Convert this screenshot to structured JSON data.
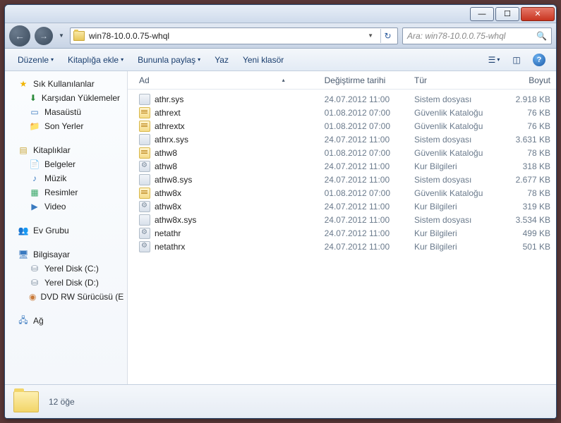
{
  "title_controls": {
    "min": "—",
    "max": "☐",
    "close": "✕"
  },
  "nav": {
    "back": "←",
    "fwd": "→",
    "drop": "▼"
  },
  "address": {
    "path": "win78-10.0.0.75-whql",
    "drop": "▼",
    "refresh": "↻"
  },
  "search": {
    "placeholder": "Ara: win78-10.0.0.75-whql",
    "icon": "🔍"
  },
  "toolbar": {
    "organize": "Düzenle",
    "library": "Kitaplığa ekle",
    "share": "Bununla paylaş",
    "burn": "Yaz",
    "newfolder": "Yeni klasör",
    "drop": "▾"
  },
  "sidebar": {
    "favorites": {
      "label": "Sık Kullanılanlar",
      "items": [
        {
          "label": "Karşıdan Yüklemeler",
          "ico": "ico-down",
          "glyph": "⬇"
        },
        {
          "label": "Masaüstü",
          "ico": "ico-desk",
          "glyph": "▭"
        },
        {
          "label": "Son Yerler",
          "ico": "ico-recent",
          "glyph": "📁"
        }
      ]
    },
    "libraries": {
      "label": "Kitaplıklar",
      "items": [
        {
          "label": "Belgeler",
          "ico": "ico-doc",
          "glyph": "📄"
        },
        {
          "label": "Müzik",
          "ico": "ico-music",
          "glyph": "♪"
        },
        {
          "label": "Resimler",
          "ico": "ico-pic",
          "glyph": "▦"
        },
        {
          "label": "Video",
          "ico": "ico-vid",
          "glyph": "▶"
        }
      ]
    },
    "homegroup": {
      "label": "Ev Grubu",
      "glyph": "👥"
    },
    "computer": {
      "label": "Bilgisayar",
      "items": [
        {
          "label": "Yerel Disk (C:)",
          "ico": "ico-disk",
          "glyph": "⛁"
        },
        {
          "label": "Yerel Disk (D:)",
          "ico": "ico-disk",
          "glyph": "⛁"
        },
        {
          "label": "DVD RW Sürücüsü (E",
          "ico": "ico-dvd",
          "glyph": "◉"
        }
      ]
    },
    "network": {
      "label": "Ağ",
      "glyph": "🖧"
    }
  },
  "columns": {
    "name": "Ad",
    "date": "Değiştirme tarihi",
    "type": "Tür",
    "size": "Boyut",
    "sort": "▴"
  },
  "files": [
    {
      "name": "athr.sys",
      "date": "24.07.2012 11:00",
      "type": "Sistem dosyası",
      "size": "2.918 KB",
      "ico": "fi-sys"
    },
    {
      "name": "athrext",
      "date": "01.08.2012 07:00",
      "type": "Güvenlik Kataloğu",
      "size": "76 KB",
      "ico": "fi-cat"
    },
    {
      "name": "athrextx",
      "date": "01.08.2012 07:00",
      "type": "Güvenlik Kataloğu",
      "size": "76 KB",
      "ico": "fi-cat"
    },
    {
      "name": "athrx.sys",
      "date": "24.07.2012 11:00",
      "type": "Sistem dosyası",
      "size": "3.631 KB",
      "ico": "fi-sys"
    },
    {
      "name": "athw8",
      "date": "01.08.2012 07:00",
      "type": "Güvenlik Kataloğu",
      "size": "78 KB",
      "ico": "fi-cat"
    },
    {
      "name": "athw8",
      "date": "24.07.2012 11:00",
      "type": "Kur Bilgileri",
      "size": "318 KB",
      "ico": "fi-inf"
    },
    {
      "name": "athw8.sys",
      "date": "24.07.2012 11:00",
      "type": "Sistem dosyası",
      "size": "2.677 KB",
      "ico": "fi-sys"
    },
    {
      "name": "athw8x",
      "date": "01.08.2012 07:00",
      "type": "Güvenlik Kataloğu",
      "size": "78 KB",
      "ico": "fi-cat"
    },
    {
      "name": "athw8x",
      "date": "24.07.2012 11:00",
      "type": "Kur Bilgileri",
      "size": "319 KB",
      "ico": "fi-inf"
    },
    {
      "name": "athw8x.sys",
      "date": "24.07.2012 11:00",
      "type": "Sistem dosyası",
      "size": "3.534 KB",
      "ico": "fi-sys"
    },
    {
      "name": "netathr",
      "date": "24.07.2012 11:00",
      "type": "Kur Bilgileri",
      "size": "499 KB",
      "ico": "fi-inf"
    },
    {
      "name": "netathrx",
      "date": "24.07.2012 11:00",
      "type": "Kur Bilgileri",
      "size": "501 KB",
      "ico": "fi-inf"
    }
  ],
  "status": {
    "count": "12 öğe"
  }
}
